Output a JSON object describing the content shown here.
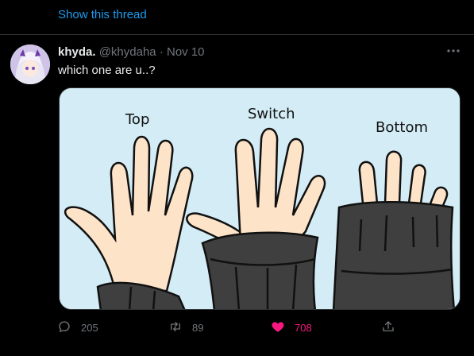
{
  "thread": {
    "show_label": "Show this thread"
  },
  "tweet": {
    "display_name": "khyda.",
    "handle": "@khydaha",
    "separator": "·",
    "date": "Nov 10",
    "text": "which one are u..?",
    "more_icon": "more-horizontal-icon"
  },
  "media": {
    "labels": {
      "top": "Top",
      "switch": "Switch",
      "bottom": "Bottom"
    },
    "colors": {
      "background": "#d3ecf5",
      "skin": "#fde3c8",
      "sleeve": "#3f3f3f"
    }
  },
  "actions": {
    "reply": {
      "icon": "reply-icon",
      "count": "205"
    },
    "retweet": {
      "icon": "retweet-icon",
      "count": "89"
    },
    "like": {
      "icon": "heart-icon",
      "count": "708",
      "active": true,
      "color": "#f91880"
    },
    "share": {
      "icon": "share-icon"
    }
  }
}
